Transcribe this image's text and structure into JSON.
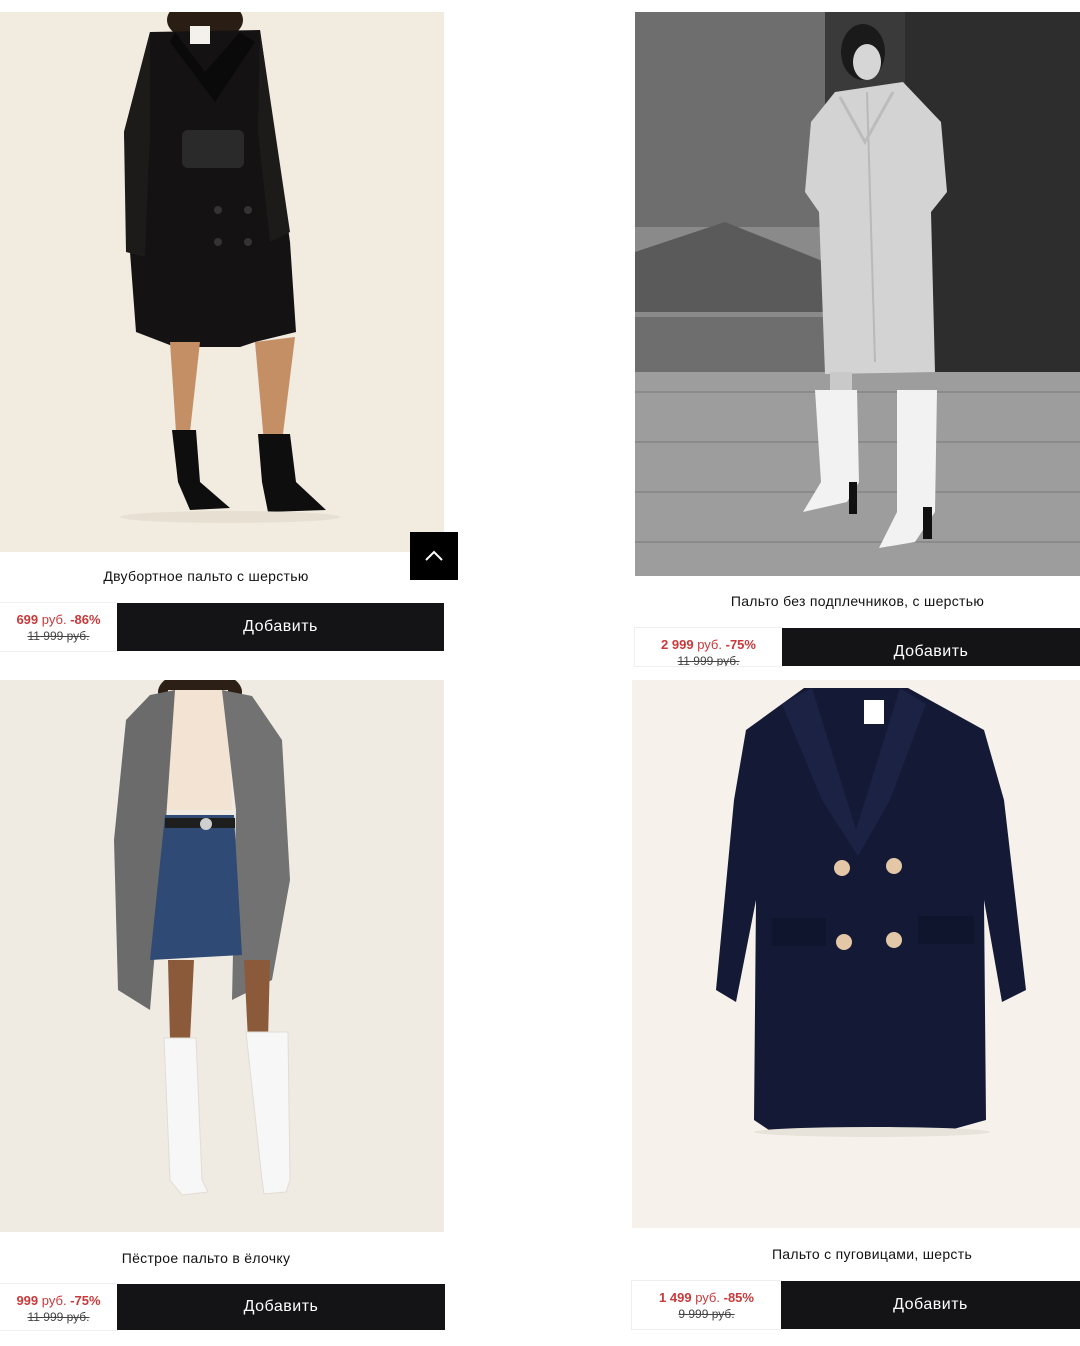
{
  "products": [
    {
      "name": "Двубортное пальто с шерстью",
      "price": "699",
      "currency": "руб.",
      "discount": "-86%",
      "old_price": "11 999 руб.",
      "add_label": "Добавить"
    },
    {
      "name": "Пальто без подплечников, с шерстью",
      "price": "2 999",
      "currency": "руб.",
      "discount": "-75%",
      "old_price": "11 999 руб.",
      "add_label": "Добавить"
    },
    {
      "name": "Пёстрое пальто в ёлочку",
      "price": "999",
      "currency": "руб.",
      "discount": "-75%",
      "old_price": "11 999 руб.",
      "add_label": "Добавить"
    },
    {
      "name": "Пальто с пуговицами, шерсть",
      "price": "1 499",
      "currency": "руб.",
      "discount": "-85%",
      "old_price": "9 999 руб.",
      "add_label": "Добавить"
    }
  ],
  "scroll_top": {
    "icon": "chevron-up-icon"
  },
  "colors": {
    "sale": "#c8393b",
    "button": "#141416",
    "background": "#ffffff"
  }
}
